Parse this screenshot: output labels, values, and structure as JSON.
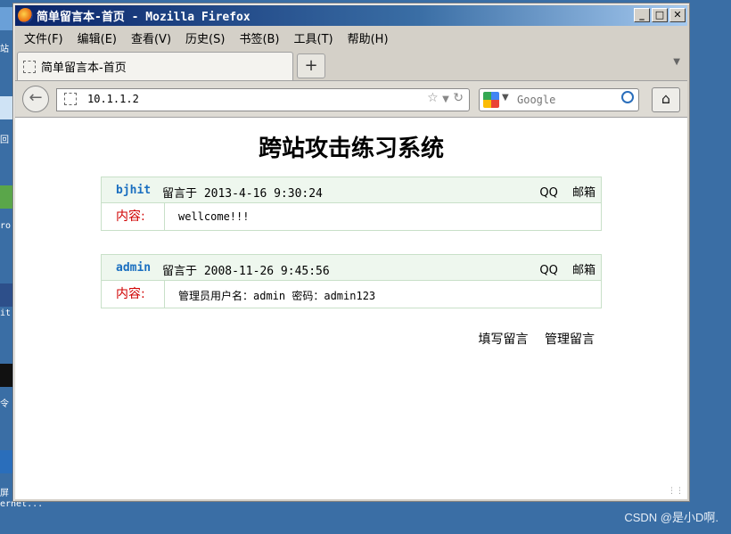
{
  "desktop": {
    "labels": [
      "站",
      "回",
      "ro",
      "it",
      "令",
      "屏",
      "ernet..."
    ]
  },
  "watermark": "CSDN @是小D啊.",
  "window": {
    "title": "简单留言本-首页 - Mozilla Firefox",
    "controls": {
      "minimize": "_",
      "maximize": "□",
      "close": "✕"
    }
  },
  "menu": [
    "文件(F)",
    "编辑(E)",
    "查看(V)",
    "历史(S)",
    "书签(B)",
    "工具(T)",
    "帮助(H)"
  ],
  "tab": {
    "label": "简单留言本-首页",
    "new_tab": "+"
  },
  "nav": {
    "url": "10.1.1.2",
    "search_placeholder": "Google"
  },
  "page": {
    "title": "跨站攻击练习系统",
    "messages": [
      {
        "user": "bjhit",
        "posted": "留言于 2013-4-16 9:30:24",
        "qq": "QQ",
        "email": "邮箱",
        "content_label": "内容:",
        "content": "wellcome!!!"
      },
      {
        "user": "admin",
        "posted": "留言于 2008-11-26 9:45:56",
        "qq": "QQ",
        "email": "邮箱",
        "content_label": "内容:",
        "content": "管理员用户名：admin 密码：admin123"
      }
    ],
    "actions": {
      "write": "填写留言",
      "manage": "管理留言"
    }
  }
}
